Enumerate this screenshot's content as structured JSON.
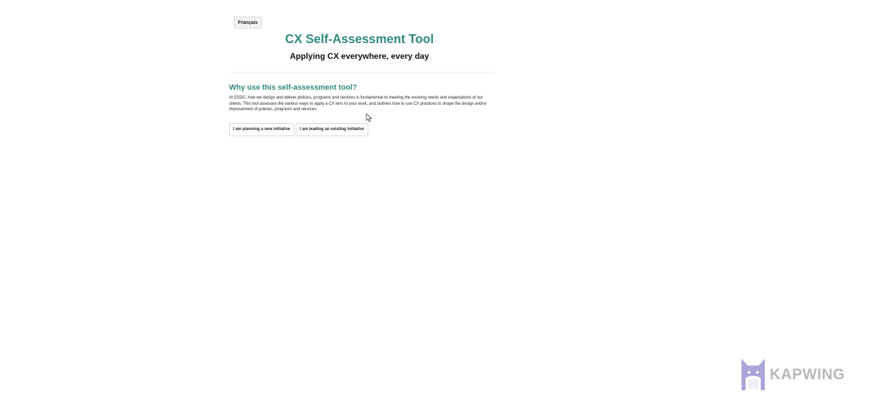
{
  "header": {
    "language_toggle_label": "Français",
    "title": "CX Self-Assessment Tool",
    "subtitle": "Applying CX everywhere, every day"
  },
  "intro": {
    "heading": "Why use this self-assessment tool?",
    "body": "At ESDC, how we design and deliver policies, programs and services is fundamental to meeting the evolving needs and expectations of our clients. This tool assesses the various ways to apply a CX lens to your work, and outlines how to use CX practices to shape the design and/or improvement of policies, programs and services."
  },
  "actions": {
    "planning_label": "I am planning a new initiative",
    "leading_label": "I am leading an existing initiative"
  },
  "watermark": {
    "text": "KAPWING"
  },
  "colors": {
    "accent": "#2f8b7c",
    "watermark": "#b9b9b9",
    "watermark_logo": "#a9a6dc"
  }
}
